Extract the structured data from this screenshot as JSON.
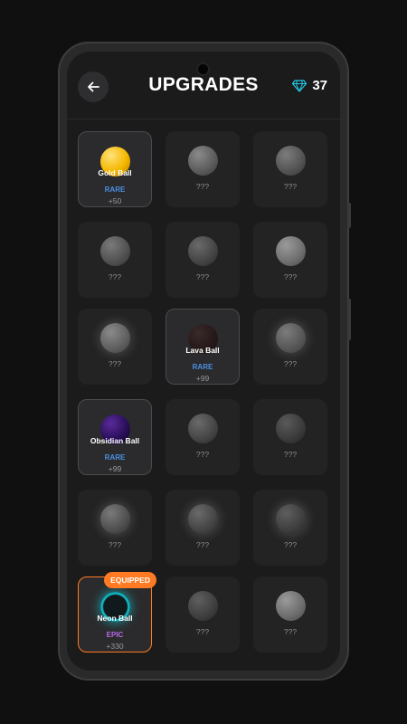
{
  "header": {
    "title": "UPGRADES",
    "back_icon": "arrow-left-icon",
    "gem_icon": "diamond-icon",
    "gem_count": "37"
  },
  "colors": {
    "accent_orange": "#ff7a22",
    "rare_blue": "#4a90e2",
    "epic_purple": "#b56be8",
    "gem_cyan": "#27c7e6"
  },
  "cards": [
    {
      "name": "Gold Ball",
      "rarity": "RARE",
      "bonus": "+50",
      "state": "unlocked"
    },
    {
      "name": "???",
      "state": "locked"
    },
    {
      "name": "???",
      "state": "locked"
    },
    {
      "name": "???",
      "state": "locked"
    },
    {
      "name": "???",
      "state": "locked"
    },
    {
      "name": "???",
      "state": "locked"
    },
    {
      "name": "???",
      "state": "locked"
    },
    {
      "name": "Lava Ball",
      "rarity": "RARE",
      "bonus": "+99",
      "state": "unlocked"
    },
    {
      "name": "???",
      "state": "locked"
    },
    {
      "name": "Obsidian Ball",
      "rarity": "RARE",
      "bonus": "+99",
      "state": "unlocked"
    },
    {
      "name": "???",
      "state": "locked"
    },
    {
      "name": "???",
      "state": "locked"
    },
    {
      "name": "???",
      "state": "locked"
    },
    {
      "name": "???",
      "state": "locked"
    },
    {
      "name": "???",
      "state": "locked"
    },
    {
      "name": "Neon Ball",
      "rarity": "EPIC",
      "bonus": "+330",
      "state": "equipped",
      "badge": "EQUIPPED"
    },
    {
      "name": "???",
      "state": "locked"
    },
    {
      "name": "???",
      "state": "locked"
    }
  ]
}
